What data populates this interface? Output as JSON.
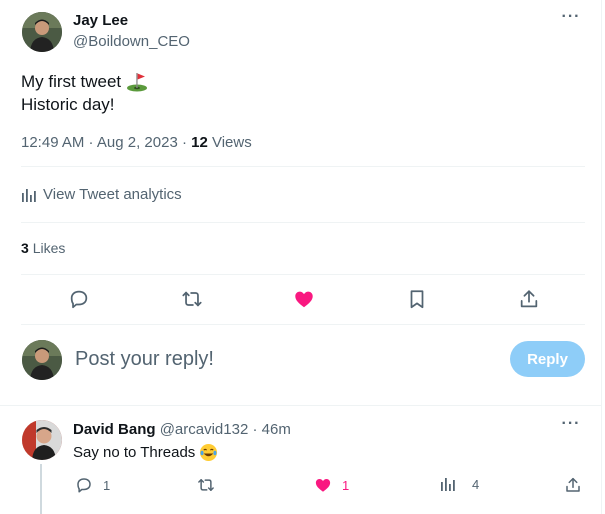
{
  "tweet": {
    "author_name": "Jay Lee",
    "author_handle": "@Boildown_CEO",
    "text_line1": "My first tweet",
    "text_line2": "Historic day!",
    "timestamp": "12:49 AM · Aug 2, 2023 ·",
    "views_count": "12",
    "views_label": "Views",
    "analytics_label": "View Tweet analytics",
    "likes_count": "3",
    "likes_label": "Likes"
  },
  "composer": {
    "placeholder": "Post your reply!",
    "reply_button_label": "Reply"
  },
  "reply": {
    "author_name": "David Bang",
    "author_handle": "@arcavid132",
    "time": "· 46m",
    "text": "Say no to Threads",
    "replies_count": "1",
    "likes_count": "1",
    "views_count": "4"
  },
  "colors": {
    "accent": "#1d9bf0",
    "like": "#f91880",
    "muted": "#536471",
    "reply_button_disabled": "#8ecdf8"
  },
  "icons": {
    "tweet_actions": [
      "reply-icon",
      "retweet-icon",
      "like-icon-filled",
      "bookmark-icon",
      "share-icon"
    ],
    "reply_actions": [
      "reply-icon",
      "retweet-icon",
      "like-icon-filled",
      "analytics-icon",
      "share-icon"
    ]
  }
}
